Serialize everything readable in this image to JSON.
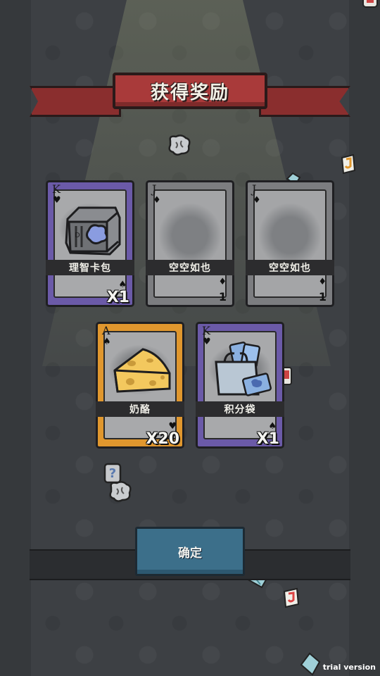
{
  "title": "获得奖励",
  "cards": [
    {
      "id": "sanity-card-pack",
      "rank": "K",
      "suit": "♥",
      "bottom_suit": "♠",
      "name": "理智卡包",
      "count": "X1",
      "frame": "purple",
      "icon": "card-pack-icon"
    },
    {
      "id": "empty-1",
      "rank": "J",
      "suit": "♦",
      "bottom_suit": "♦",
      "name": "空空如也",
      "count": "1",
      "frame": "gray",
      "icon": "empty-smudge-icon"
    },
    {
      "id": "empty-2",
      "rank": "J",
      "suit": "♦",
      "bottom_suit": "♦",
      "name": "空空如也",
      "count": "1",
      "frame": "gray",
      "icon": "empty-smudge-icon"
    },
    {
      "id": "cheese",
      "rank": "A",
      "suit": "♠",
      "bottom_suit": "♥",
      "name": "奶酪",
      "count": "X20",
      "frame": "orange",
      "icon": "cheese-icon"
    },
    {
      "id": "points-bag",
      "rank": "K",
      "suit": "♥",
      "bottom_suit": "♠",
      "name": "积分袋",
      "count": "X1",
      "frame": "purple",
      "icon": "points-bag-icon"
    }
  ],
  "confirm_label": "确定",
  "watermark": "trial version",
  "colors": {
    "banner": "#a93a3a",
    "purple_frame": "#6b5aa8",
    "orange_frame": "#e0972e",
    "gray_frame": "#7c7d80",
    "confirm": "#3c6f8a"
  }
}
